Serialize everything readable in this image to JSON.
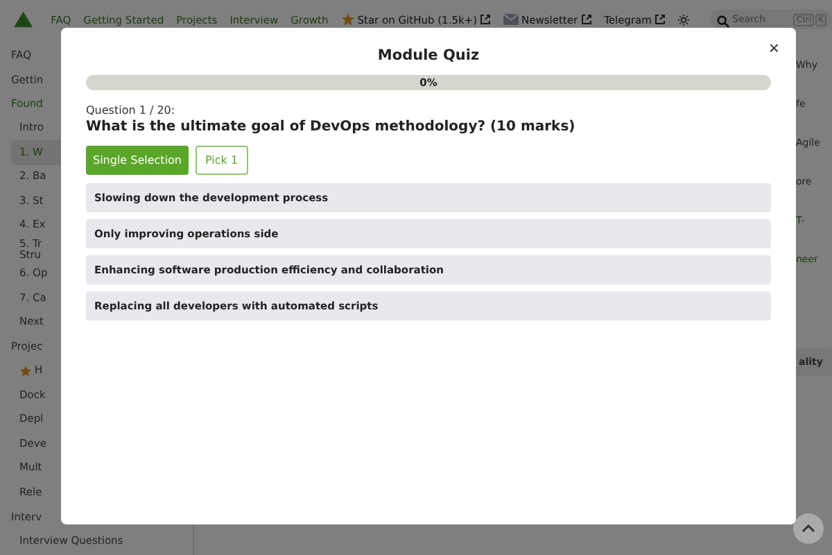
{
  "nav": {
    "links": [
      {
        "label": "FAQ",
        "kind": "link"
      },
      {
        "label": "Getting Started",
        "kind": "link"
      },
      {
        "label": "Projects",
        "kind": "link"
      },
      {
        "label": "Interview",
        "kind": "link"
      },
      {
        "label": "Growth",
        "kind": "link"
      },
      {
        "label": "Star on GitHub (1.5k+)",
        "kind": "star"
      },
      {
        "label": "Newsletter",
        "kind": "mail"
      },
      {
        "label": "Telegram",
        "kind": "plain"
      }
    ],
    "search": {
      "placeholder": "Search",
      "keys": [
        "Ctrl",
        "K"
      ]
    }
  },
  "sidebar": {
    "items": [
      {
        "label": "FAQ",
        "active": false
      },
      {
        "label": "Gettin",
        "active": false
      },
      {
        "label": "Found",
        "active": true,
        "children": [
          {
            "label": "Intro",
            "selected": false,
            "starred": false
          },
          {
            "label": "1. W",
            "selected": true,
            "starred": false
          },
          {
            "label": "2. Ba",
            "selected": false,
            "starred": false
          },
          {
            "label": "3. St",
            "selected": false,
            "starred": false
          },
          {
            "label": "4. Ex",
            "selected": false,
            "starred": false
          },
          {
            "label": "5. Tr\nStru",
            "selected": false,
            "starred": false
          },
          {
            "label": "6. Op",
            "selected": false,
            "starred": false
          },
          {
            "label": "7. Ca",
            "selected": false,
            "starred": false
          },
          {
            "label": "Next",
            "selected": false,
            "starred": false
          }
        ]
      },
      {
        "label": "Projec",
        "active": false,
        "children": [
          {
            "label": "H",
            "selected": false,
            "starred": true
          },
          {
            "label": "Dock",
            "selected": false,
            "starred": false
          },
          {
            "label": "Depl",
            "selected": false,
            "starred": false
          },
          {
            "label": "Deve",
            "selected": false,
            "starred": false
          },
          {
            "label": "Mult",
            "selected": false,
            "starred": false
          },
          {
            "label": "Rele",
            "selected": false,
            "starred": false
          }
        ]
      },
      {
        "label": "Interv",
        "active": false,
        "children": [
          {
            "label": "Interview Questions",
            "selected": false,
            "starred": false
          }
        ]
      }
    ]
  },
  "right_column": [
    {
      "text": "Why",
      "kind": "text"
    },
    {
      "text": "fe",
      "kind": "text"
    },
    {
      "text": "Agile",
      "kind": "text"
    },
    {
      "text": "ore",
      "kind": "text"
    },
    {
      "text": "T-",
      "kind": "link"
    },
    {
      "text": "neer",
      "kind": "link"
    },
    {
      "text": "ality",
      "kind": "card"
    }
  ],
  "modal": {
    "title": "Module Quiz",
    "close": "×",
    "progress": {
      "level": 0,
      "label": "0%"
    },
    "question_number": "Question 1 / 20:",
    "question": "What is the ultimate goal of DevOps methodology? (10 marks)",
    "tags": [
      {
        "label": "Single Selection",
        "kind": "filled"
      },
      {
        "label": "Pick 1",
        "kind": "outline"
      }
    ],
    "options": [
      {
        "text": "Slowing down the development process",
        "selected": false
      },
      {
        "text": "Only improving operations side",
        "selected": false
      },
      {
        "text": "Enhancing software production efficiency and collaboration",
        "selected": false
      },
      {
        "text": "Replacing all developers with automated scripts",
        "selected": false
      }
    ]
  }
}
